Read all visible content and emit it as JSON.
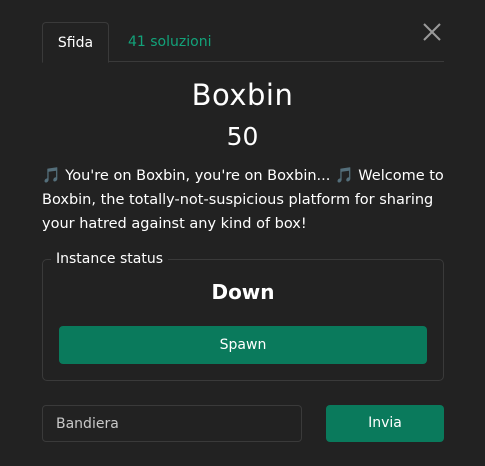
{
  "tabs": [
    {
      "label": "Sfida"
    },
    {
      "label": "41 soluzioni"
    }
  ],
  "challenge": {
    "title": "Boxbin",
    "points": "50",
    "description_parts": [
      "🎵",
      " You're on Boxbin, you're on Boxbin... ",
      "🎵",
      " Welcome to Boxbin, the totally-not-suspicious platform for sharing your hatred against any kind of box!"
    ]
  },
  "instance": {
    "legend": "Instance status",
    "status": "Down",
    "spawn_label": "Spawn"
  },
  "flag_form": {
    "placeholder": "Bandiera",
    "submit_label": "Invia"
  },
  "colors": {
    "accent": "#0a7a5c",
    "link": "#12a37a",
    "background": "#222222"
  },
  "icons": {
    "close": "close-icon",
    "note": "musical-notes-icon"
  }
}
